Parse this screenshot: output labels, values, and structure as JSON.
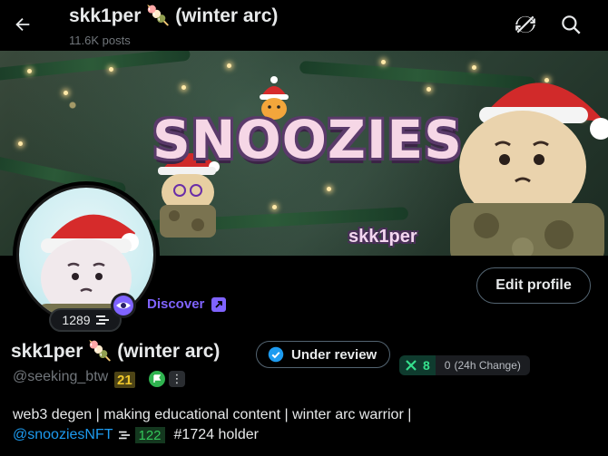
{
  "header": {
    "title": "skk1per 🍡 (winter arc)",
    "posts_count": "11.6K posts",
    "back_icon": "arrow-left-icon",
    "refresh_icon": "refresh-icon",
    "search_icon": "search-icon"
  },
  "banner": {
    "logo_text": "SNOOZIES",
    "handle_text": "skk1per"
  },
  "profile": {
    "follower_pill": "1289",
    "discover_label": "Discover",
    "edit_button": "Edit profile",
    "display_name": "skk1per 🍡 (winter arc)",
    "review_badge": "Under review",
    "xscore": {
      "value": "8",
      "change_value": "0",
      "change_label": "(24h Change)"
    },
    "handle": "@seeking_btw",
    "badge_number": "21",
    "bio_line1": "web3 degen | making educational content | winter arc warrior |",
    "bio_mention": "@snooziesNFT",
    "bio_badge": "122",
    "bio_tail": "#1724 holder"
  },
  "colors": {
    "accent_blue": "#1d9bf0",
    "discover_purple": "#7f63ff",
    "xscore_green": "#35e08c",
    "badge_yellow": "#f2c92b"
  }
}
